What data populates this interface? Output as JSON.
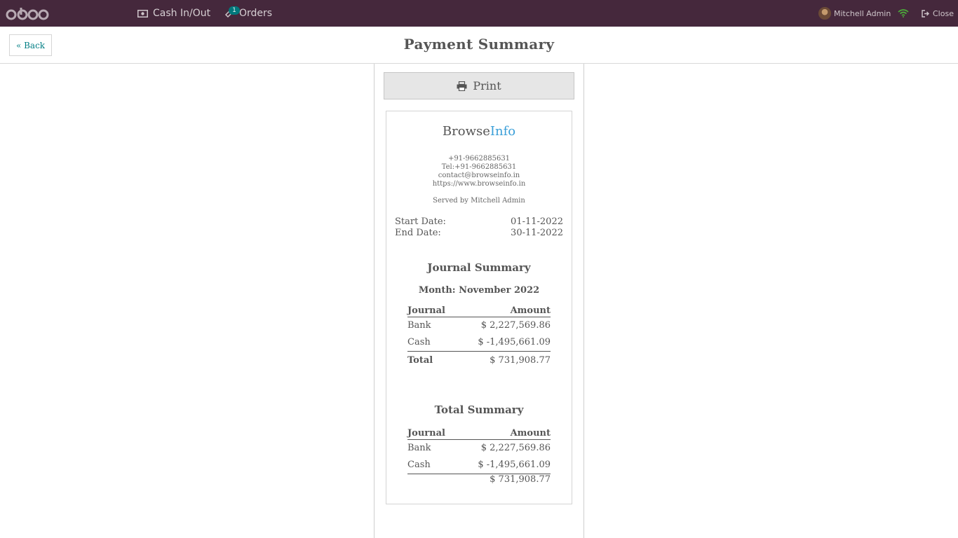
{
  "navbar": {
    "cash_label": "Cash In/Out",
    "orders_label": "Orders",
    "orders_badge": "1",
    "user_name": "Mitchell Admin",
    "close_label": "Close",
    "bg_color": "#45283c"
  },
  "header": {
    "back_label": "« Back",
    "title": "Payment Summary"
  },
  "print_label": "Print",
  "receipt": {
    "brand_primary": "Browse",
    "brand_accent": "Info",
    "phone": "+91-9662885631",
    "tel": "Tel:+91-9662885631",
    "email": "contact@browseinfo.in",
    "website": "https://www.browseinfo.in",
    "served_by": "Served by Mitchell Admin",
    "start_label": "Start Date:",
    "start_value": "01-11-2022",
    "end_label": "End Date:",
    "end_value": "30-11-2022",
    "journal_summary": {
      "title": "Journal Summary",
      "month": "Month: November 2022",
      "col_journal": "Journal",
      "col_amount": "Amount",
      "rows": [
        {
          "journal": "Bank",
          "amount": "$ 2,227,569.86"
        },
        {
          "journal": "Cash",
          "amount": "$ -1,495,661.09"
        }
      ],
      "total_label": "Total",
      "total_value": "$ 731,908.77"
    },
    "total_summary": {
      "title": "Total Summary",
      "col_journal": "Journal",
      "col_amount": "Amount",
      "rows": [
        {
          "journal": "Bank",
          "amount": "$ 2,227,569.86"
        },
        {
          "journal": "Cash",
          "amount": "$ -1,495,661.09"
        }
      ],
      "total_value": "$ 731,908.77"
    }
  }
}
